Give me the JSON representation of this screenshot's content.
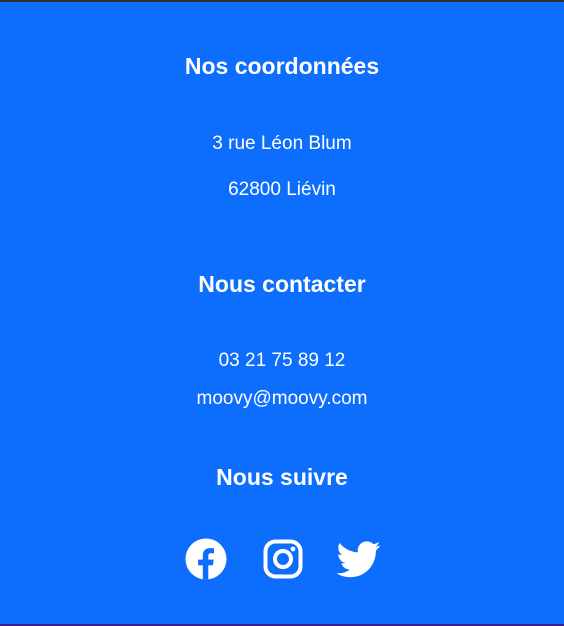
{
  "coordinates": {
    "title": "Nos coordonnées",
    "address_line1": "3 rue Léon Blum",
    "address_line2": "62800 Liévin"
  },
  "contact": {
    "title": "Nous contacter",
    "phone": "03 21 75 89 12",
    "email": "moovy@moovy.com"
  },
  "follow": {
    "title": "Nous suivre",
    "icons": [
      "facebook-icon",
      "instagram-icon",
      "twitter-icon"
    ]
  },
  "colors": {
    "background": "#0d6efd",
    "text": "#ffffff"
  }
}
